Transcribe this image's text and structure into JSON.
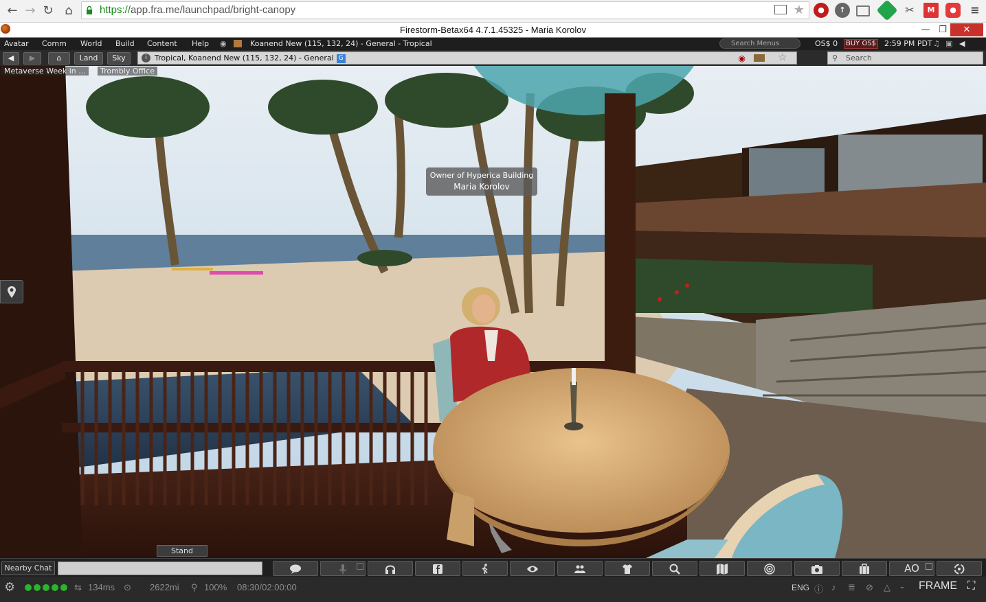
{
  "browser": {
    "url_scheme": "https://",
    "url_rest": "app.fra.me/launchpad/bright-canopy"
  },
  "window": {
    "title": "Firestorm-Betax64 4.7.1.45325 - Maria Korolov",
    "close_glyph": "✕",
    "minimize_glyph": "—",
    "maximize_glyph": "❐"
  },
  "menu": {
    "items": [
      "Avatar",
      "Comm",
      "World",
      "Build",
      "Content",
      "Help"
    ],
    "location": "Koanend New (115, 132, 24) - General - Tropical",
    "search_placeholder": "Search Menus",
    "balance": "OS$ 0",
    "buy_label": "BUY OS$",
    "time": "2:59 PM PDT"
  },
  "navbar": {
    "land_label": "Land",
    "sky_label": "Sky",
    "location_value": "Tropical, Koanend New (115, 132, 24) - General",
    "location_badge": "G",
    "search_placeholder": "Search"
  },
  "favorites": {
    "items": [
      "Metaverse Week in ...",
      "Trombly Office"
    ]
  },
  "scene": {
    "hover_title": "Owner of Hyperica Building",
    "hover_name": "Maria Korolov",
    "stand_label": "Stand"
  },
  "bottom": {
    "chat_label": "Nearby Chat",
    "ao_label": "AO"
  },
  "status": {
    "ping": "134ms",
    "distance": "2622mi",
    "zoom": "100%",
    "clock": "08:30/02:00:00",
    "lang": "ENG",
    "frame_label": "FRAME"
  },
  "colors": {
    "accent_green": "#2bb52b",
    "close_red": "#c7312b",
    "url_green": "#1a8a1a"
  }
}
